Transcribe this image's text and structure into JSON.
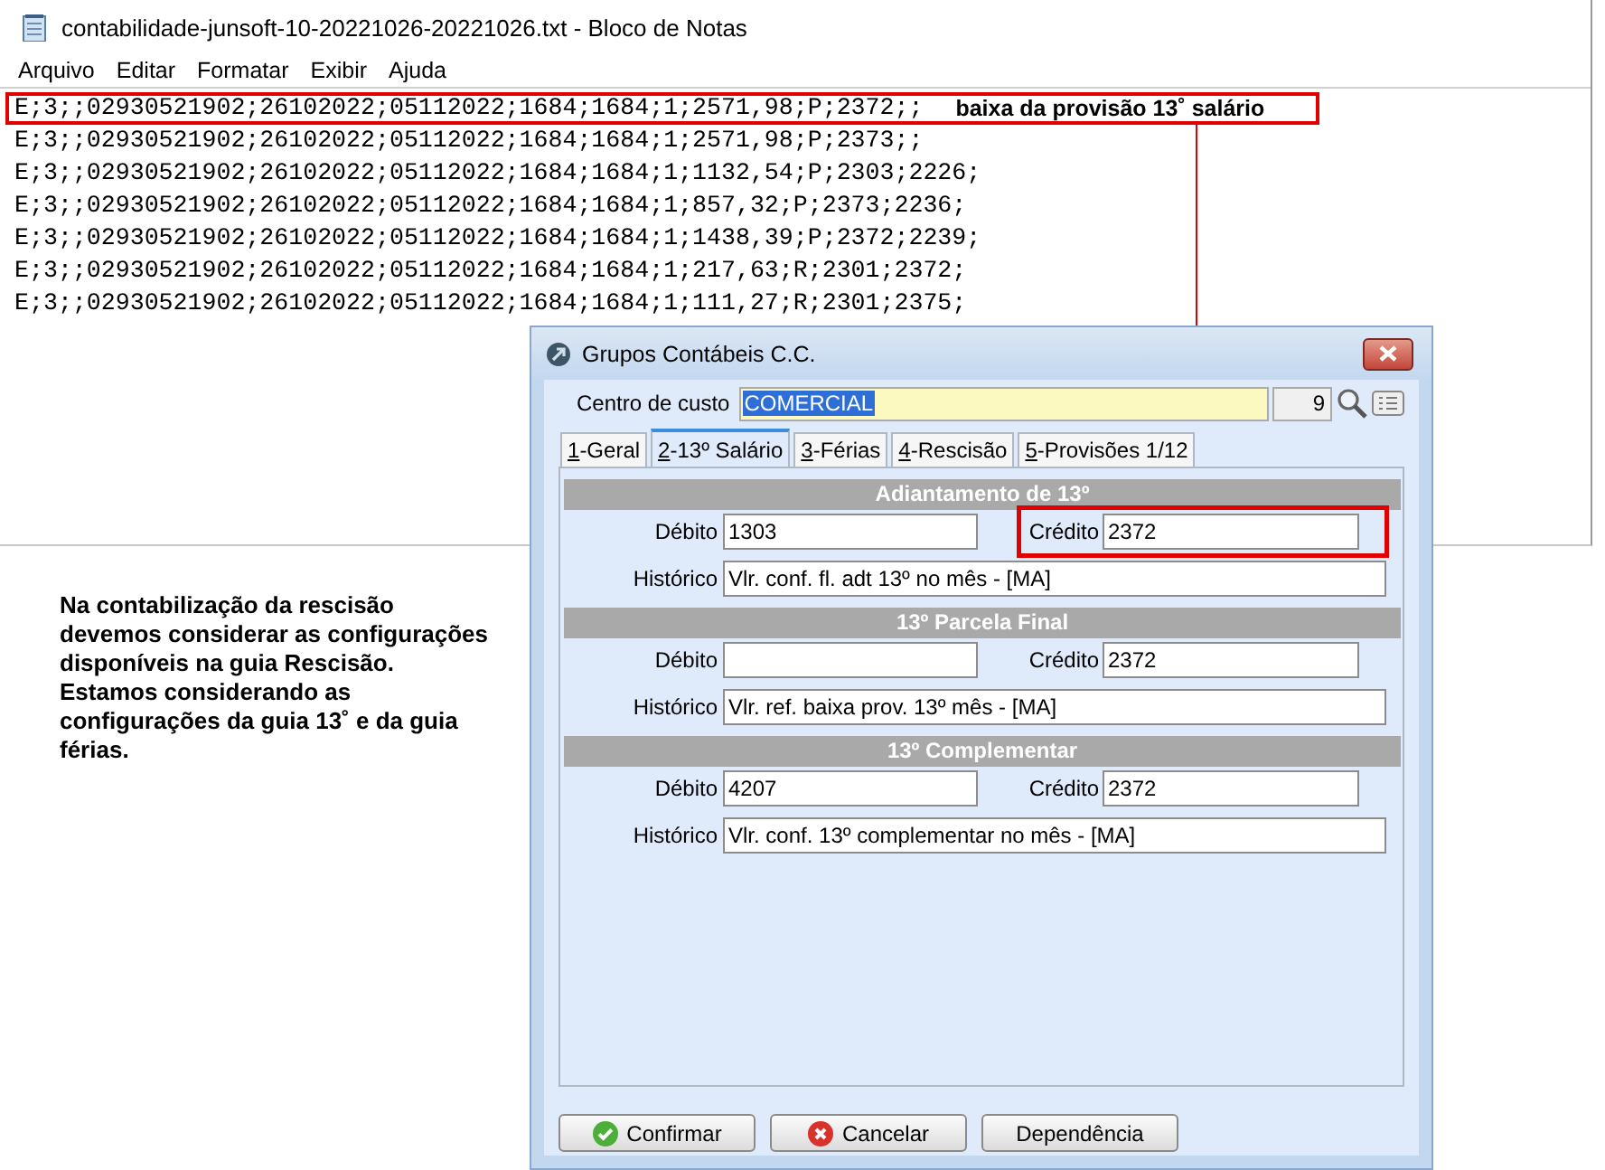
{
  "notepad": {
    "title": "contabilidade-junsoft-10-20221026-20221026.txt - Bloco de Notas",
    "menu": [
      "Arquivo",
      "Editar",
      "Formatar",
      "Exibir",
      "Ajuda"
    ],
    "lines": [
      {
        "text": "E;3;;02930521902;26102022;05112022;1684;1684;1;2571,98;P;2372;;",
        "highlighted": true,
        "note": "baixa da provisão 13˚ salário"
      },
      {
        "text": "E;3;;02930521902;26102022;05112022;1684;1684;1;2571,98;P;2373;;",
        "highlighted": false
      },
      {
        "text": "E;3;;02930521902;26102022;05112022;1684;1684;1;1132,54;P;2303;2226;",
        "highlighted": false
      },
      {
        "text": "E;3;;02930521902;26102022;05112022;1684;1684;1;857,32;P;2373;2236;",
        "highlighted": false
      },
      {
        "text": "E;3;;02930521902;26102022;05112022;1684;1684;1;1438,39;P;2372;2239;",
        "highlighted": false
      },
      {
        "text": "E;3;;02930521902;26102022;05112022;1684;1684;1;217,63;R;2301;2372;",
        "highlighted": false
      },
      {
        "text": "E;3;;02930521902;26102022;05112022;1684;1684;1;111,27;R;2301;2375;",
        "highlighted": false
      }
    ]
  },
  "annotation": "Na contabilização da rescisão devemos considerar as configurações disponíveis na guia Rescisão. Estamos considerando as configurações da guia 13˚ e da guia férias.",
  "dialog": {
    "title": "Grupos Contábeis C.C.",
    "cost_center_label": "Centro de custo",
    "cost_center": "COMERCIAL",
    "code": "9",
    "tabs": [
      {
        "label": "1-Geral",
        "selected": false
      },
      {
        "label": "2-13º Salário",
        "selected": true
      },
      {
        "label": "3-Férias",
        "selected": false
      },
      {
        "label": "4-Rescisão",
        "selected": false
      },
      {
        "label": "5-Provisões 1/12",
        "selected": false
      }
    ],
    "sections": [
      {
        "title": "Adiantamento de 13º",
        "fields": [
          {
            "kind": "short",
            "label": "Débito",
            "value": "1303",
            "highlighted": false
          },
          {
            "kind": "short",
            "label": "Crédito",
            "value": "2372",
            "highlighted": true
          },
          {
            "kind": "wide",
            "label": "Histórico",
            "value": "Vlr. conf. fl. adt 13º no mês - [MA]",
            "highlighted": false
          }
        ]
      },
      {
        "title": "13º Parcela Final",
        "fields": [
          {
            "kind": "short",
            "label": "Débito",
            "highlighted": false
          },
          {
            "kind": "short",
            "label": "Crédito",
            "value": "2372",
            "highlighted": false
          },
          {
            "kind": "wide",
            "label": "Histórico",
            "value": "Vlr. ref. baixa prov. 13º mês - [MA]",
            "highlighted": false
          }
        ]
      },
      {
        "title": "13º Complementar",
        "fields": [
          {
            "kind": "short",
            "label": "Débito",
            "value": "4207",
            "highlighted": false
          },
          {
            "kind": "short",
            "label": "Crédito",
            "value": "2372",
            "highlighted": false
          },
          {
            "kind": "wide",
            "label": "Histórico",
            "value": "Vlr. conf. 13º complementar no mês - [MA]",
            "highlighted": false
          }
        ]
      }
    ],
    "buttons": [
      {
        "kind": "confirm",
        "label": "Confirmar"
      },
      {
        "kind": "cancel",
        "label": "Cancelar"
      },
      {
        "kind": "plain",
        "label": "Dependência"
      }
    ]
  }
}
